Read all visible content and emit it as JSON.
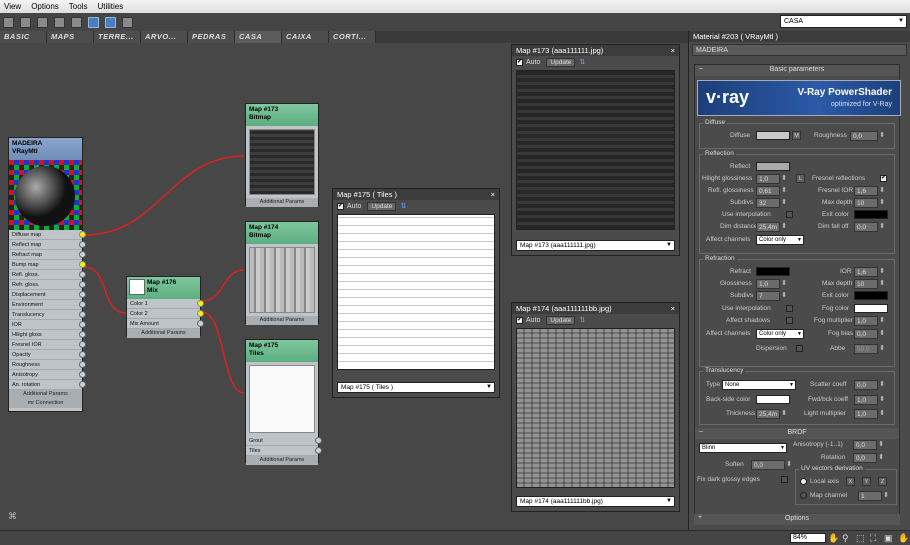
{
  "menu": [
    "View",
    "Options",
    "Tools",
    "Utilities"
  ],
  "view_dropdown": "CASA",
  "tabs": [
    "BASIC",
    "MAPS",
    "TERRE...",
    "ARVO...",
    "PEDRAS",
    "CASA",
    "CAIXA",
    "CORTI..."
  ],
  "nodes": {
    "vray_mtl": {
      "title": "MADEIRA",
      "subtitle": "VRayMtl",
      "slots": [
        "Diffuse map",
        "Reflect map",
        "Refract map",
        "Bump map",
        "Refl. gloss.",
        "Refr. gloss.",
        "Displacement",
        "Environment",
        "Translucency",
        "IOR",
        "Hilight gloss",
        "Fresnel IOR",
        "Opacity",
        "Roughness",
        "Anisotropy",
        "An. rotation"
      ],
      "footer1": "Additional Params",
      "footer2": "mr Connection"
    },
    "mix": {
      "title": "Map #176",
      "subtitle": "Mix",
      "slots": [
        "Color 1",
        "Color 2",
        "Mix Amount"
      ],
      "footer": "Additional Params"
    },
    "map173": {
      "title": "Map #173",
      "subtitle": "Bitmap",
      "footer": "Additional Params"
    },
    "map174": {
      "title": "Map #174",
      "subtitle": "Bitmap",
      "footer": "Additional Params"
    },
    "map175": {
      "title": "Map #175",
      "subtitle": "Tiles",
      "slots": [
        "Grout",
        "Tiles"
      ],
      "footer": "Additional Params"
    }
  },
  "windows": {
    "w175": {
      "title": "Map #175  ( Tiles )",
      "auto": "Auto",
      "update": "Update",
      "dropdown": "Map #175  ( Tiles )"
    },
    "w173": {
      "title": "Map #173  (aaa111111.jpg)",
      "auto": "Auto",
      "update": "Update",
      "dropdown": "Map #173 (aaa111111.jpg)"
    },
    "w174": {
      "title": "Map #174  (aaa111111bb.jpg)",
      "auto": "Auto",
      "update": "Update",
      "dropdown": "Map #174 (aaa111111bb.jpg)"
    }
  },
  "right_panel": {
    "title": "Material #203  ( VRayMtl )",
    "name": "MADEIRA",
    "basic_params": "Basic parameters",
    "banner_logo": "v·ray",
    "banner_title": "V-Ray PowerShader",
    "banner_sub": "optimized for V-Ray",
    "diffuse": {
      "group": "Diffuse",
      "diffuse": "Diffuse",
      "m": "M",
      "roughness": "Roughness",
      "roughness_val": "0,0"
    },
    "reflection": {
      "group": "Reflection",
      "reflect": "Reflect",
      "hilight": "Hilight glossiness",
      "hilight_val": "1,0",
      "l": "L",
      "fresnel": "Fresnel reflections",
      "refl_gloss": "Refl. glossiness",
      "refl_gloss_val": "0,61",
      "fresnel_ior": "Fresnel IOR",
      "fresnel_ior_val": "1,6",
      "subdivs": "Subdivs",
      "subdivs_val": "32",
      "max_depth": "Max depth",
      "max_depth_val": "10",
      "use_interp": "Use interpolation",
      "exit_color": "Exit color",
      "dim_dist": "Dim distance",
      "dim_dist_val": "25,4m",
      "dim_falloff": "Dim fall off",
      "dim_falloff_val": "0,0",
      "affect": "Affect channels",
      "affect_val": "Color only"
    },
    "refraction": {
      "group": "Refraction",
      "refract": "Refract",
      "ior": "IOR",
      "ior_val": "1,6",
      "gloss": "Glossiness",
      "gloss_val": "1,0",
      "max_depth": "Max depth",
      "max_depth_val": "10",
      "subdivs": "Subdivs",
      "subdivs_val": "7",
      "exit_color": "Exit color",
      "use_interp": "Use interpolation",
      "fog_color": "Fog color",
      "affect_shadows": "Affect shadows",
      "fog_mult": "Fog multiplier",
      "fog_mult_val": "1,0",
      "affect": "Affect channels",
      "affect_val": "Color only",
      "fog_bias": "Fog bias",
      "fog_bias_val": "0,0",
      "dispersion": "Dispersion",
      "abbe": "Abbe",
      "abbe_val": "50,0"
    },
    "translucency": {
      "group": "Translucency",
      "type": "Type",
      "type_val": "None",
      "scatter": "Scatter coeff",
      "scatter_val": "0,0",
      "backside": "Back-side color",
      "fwd": "Fwd/bck coeff",
      "fwd_val": "1,0",
      "thickness": "Thickness",
      "thickness_val": "25,4m",
      "light_mult": "Light multiplier",
      "light_mult_val": "1,0"
    },
    "brdf": {
      "bar": "BRDF",
      "type": "Blinn",
      "aniso": "Anisotropy (-1..1)",
      "aniso_val": "0,0",
      "rotation": "Rotation",
      "rotation_val": "0,0",
      "soften": "Soften",
      "soften_val": "0,0",
      "uv_group": "UV vectors derivation",
      "local_axis": "Local axis",
      "x": "X",
      "y": "Y",
      "z": "Z",
      "fix_dark": "Fix dark glossy edges",
      "map_channel": "Map channel",
      "map_channel_val": "1"
    },
    "options_bar": "Options"
  },
  "status": {
    "zoom": "84%"
  },
  "colors": {
    "node_green": "#6cbb8c",
    "node_blue": "#7e9ac2",
    "wire": "#e02020",
    "socket": "#f5f500"
  }
}
